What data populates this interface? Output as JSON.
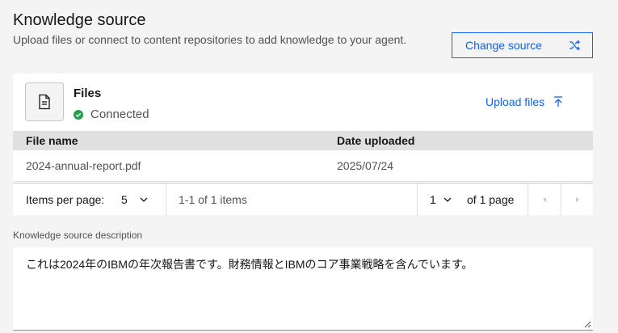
{
  "header": {
    "title": "Knowledge source",
    "subtitle": "Upload files or connect to content repositories to add knowledge to your agent.",
    "change_source_label": "Change source"
  },
  "files_card": {
    "title": "Files",
    "status": "Connected",
    "upload_label": "Upload files",
    "table": {
      "columns": [
        "File name",
        "Date uploaded"
      ],
      "rows": [
        {
          "file_name": "2024-annual-report.pdf",
          "date": "2025/07/24"
        }
      ]
    },
    "pagination": {
      "items_per_page_label": "Items per page:",
      "items_per_page_value": "5",
      "range_text": "1-1 of 1 items",
      "page_value": "1",
      "of_pages_text": "of 1 page"
    }
  },
  "description": {
    "label": "Knowledge source description",
    "value": "これは2024年のIBMの年次報告書です。財務情報とIBMのコア事業戦略を含んでいます。"
  },
  "colors": {
    "accent": "#0f62fe",
    "success": "#24a148"
  }
}
